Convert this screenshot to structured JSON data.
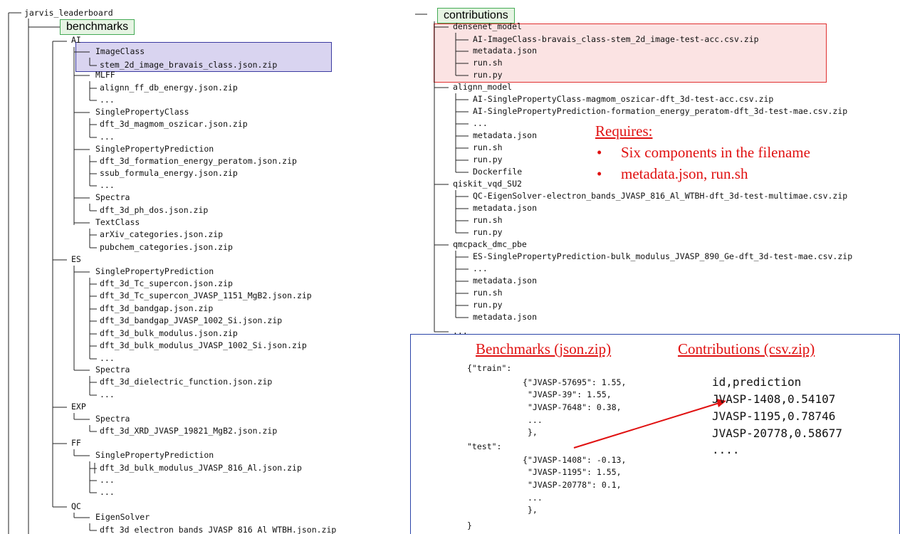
{
  "left_tree": {
    "root": "jarvis_leaderboard",
    "benchmarks_label": "benchmarks",
    "ai": "AI",
    "imageclass": "ImageClass",
    "imageclass_file": "stem_2d_image_bravais_class.json.zip",
    "mlff": "MLFF",
    "mlff_file": "alignn_ff_db_energy.json.zip",
    "ellipsis": "...",
    "spc": "SinglePropertyClass",
    "spc_file": "dft_3d_magmom_oszicar.json.zip",
    "spp": "SinglePropertyPrediction",
    "spp_file1": "dft_3d_formation_energy_peratom.json.zip",
    "spp_file2": "ssub_formula_energy.json.zip",
    "spectra": "Spectra",
    "spectra_file": "dft_3d_ph_dos.json.zip",
    "textclass": "TextClass",
    "textclass_file1": "arXiv_categories.json.zip",
    "textclass_file2": "pubchem_categories.json.zip",
    "es": "ES",
    "es_spp": "SinglePropertyPrediction",
    "es_f1": "dft_3d_Tc_supercon.json.zip",
    "es_f2": "dft_3d_Tc_supercon_JVASP_1151_MgB2.json.zip",
    "es_f3": "dft_3d_bandgap.json.zip",
    "es_f4": "dft_3d_bandgap_JVASP_1002_Si.json.zip",
    "es_f5": "dft_3d_bulk_modulus.json.zip",
    "es_f6": "dft_3d_bulk_modulus_JVASP_1002_Si.json.zip",
    "es_spectra": "Spectra",
    "es_spectra_file": "dft_3d_dielectric_function.json.zip",
    "exp": "EXP",
    "exp_spectra": "Spectra",
    "exp_file": "dft_3d_XRD_JVASP_19821_MgB2.json.zip",
    "ff": "FF",
    "ff_spp": "SinglePropertyPrediction",
    "ff_file": "dft_3d_bulk_modulus_JVASP_816_Al.json.zip",
    "qc": "QC",
    "qc_eig": "EigenSolver",
    "qc_file": "dft_3d_electron_bands_JVASP_816_Al_WTBH.json.zip"
  },
  "right_tree": {
    "contributions_label": "contributions",
    "densenet": "densenet_model",
    "densenet_f1": "AI-ImageClass-bravais_class-stem_2d_image-test-acc.csv.zip",
    "metadata": "metadata.json",
    "runsh": "run.sh",
    "runpy": "run.py",
    "alignn": "alignn_model",
    "alignn_f1": "AI-SinglePropertyClass-magmom_oszicar-dft_3d-test-acc.csv.zip",
    "alignn_f2": "AI-SinglePropertyPrediction-formation_energy_peratom-dft_3d-test-mae.csv.zip",
    "ellipsis": "...",
    "dockerfile": "Dockerfile",
    "qiskit": "qiskit_vqd_SU2",
    "qiskit_f1": "QC-EigenSolver-electron_bands_JVASP_816_Al_WTBH-dft_3d-test-multimae.csv.zip",
    "qmc": "qmcpack_dmc_pbe",
    "qmc_f1": "ES-SinglePropertyPrediction-bulk_modulus_JVASP_890_Ge-dft_3d-test-mae.csv.zip"
  },
  "requires": {
    "title": "Requires:",
    "bullet": "•",
    "item1": "Six components in the filename",
    "item2": "metadata.json, run.sh"
  },
  "example": {
    "benchmarks_heading": "Benchmarks (json.zip)",
    "contributions_heading": "Contributions (csv.zip)",
    "json_lines": [
      "{\"train\":",
      "{\"JVASP-57695\": 1.55,",
      "\"JVASP-39\": 1.55,",
      "\"JVASP-7648\": 0.38,",
      "...",
      "},",
      "\"test\":",
      "{\"JVASP-1408\": -0.13,",
      "\"JVASP-1195\": 1.55,",
      "\"JVASP-20778\": 0.1,",
      "...",
      "},",
      "}"
    ],
    "csv_lines": [
      "id,prediction",
      "JVASP-1408,0.54107",
      "JVASP-1195,0.78746",
      "JVASP-20778,0.58677",
      "...."
    ]
  },
  "colors": {
    "green_fill": "#e6f4e3",
    "green_border": "#44aa55",
    "blue_fill": "#d9d4f0",
    "blue_border": "#3a3aa0",
    "red_fill": "#fbe3e3",
    "red_border": "#e03030",
    "red_text": "#e01010",
    "panel_border": "#2a44a8"
  }
}
